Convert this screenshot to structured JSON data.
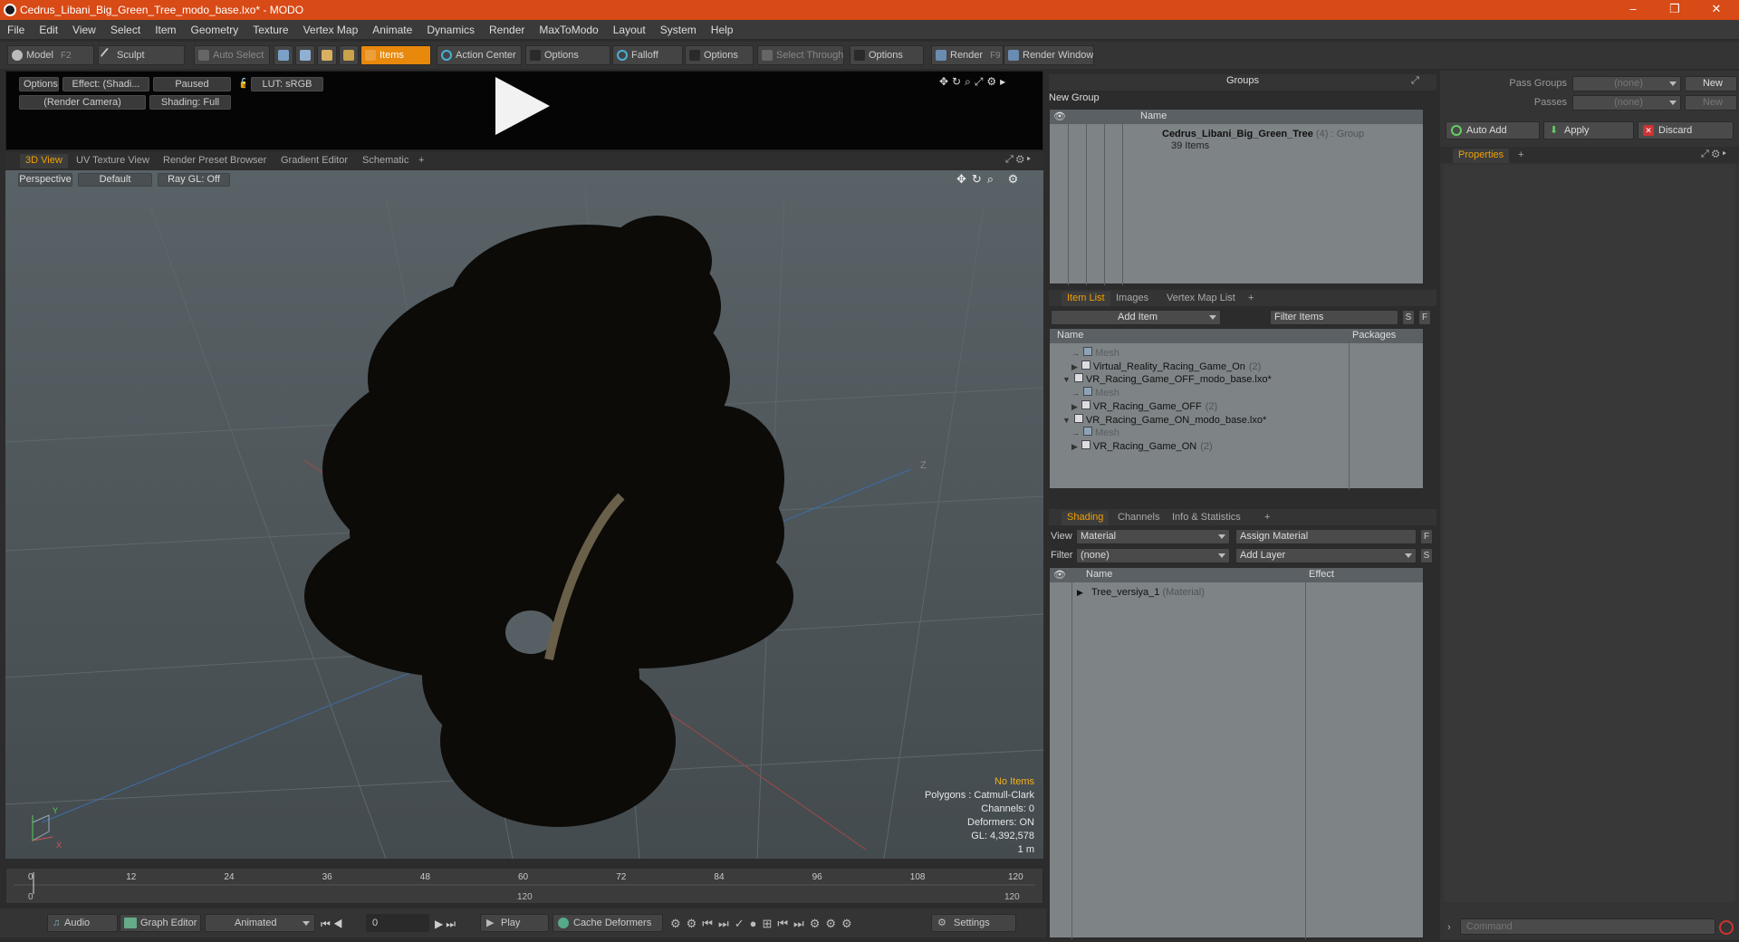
{
  "window": {
    "title": "Cedrus_Libani_Big_Green_Tree_modo_base.lxo* - MODO",
    "minimize": "–",
    "maximize": "❐",
    "close": "✕"
  },
  "menu": [
    "File",
    "Edit",
    "View",
    "Select",
    "Item",
    "Geometry",
    "Texture",
    "Vertex Map",
    "Animate",
    "Dynamics",
    "Render",
    "MaxToModo",
    "Layout",
    "System",
    "Help"
  ],
  "toolbar": {
    "model": "Model",
    "model_key": "F2",
    "sculpt": "Sculpt",
    "auto_select": "Auto Select",
    "items": "Items",
    "action_center": "Action Center",
    "options1": "Options",
    "falloff": "Falloff",
    "options2": "Options",
    "select_through": "Select Through",
    "options3": "Options",
    "render": "Render",
    "render_key": "F9",
    "render_window": "Render Window"
  },
  "preview": {
    "options": "Options",
    "effect": "Effect: (Shadi...",
    "paused": "Paused",
    "lut": "LUT: sRGB",
    "camera": "(Render Camera)",
    "shading": "Shading: Full"
  },
  "view_tabs": [
    "3D View",
    "UV Texture View",
    "Render Preset Browser",
    "Gradient Editor",
    "Schematic",
    "+"
  ],
  "viewport": {
    "perspective": "Perspective",
    "default": "Default",
    "raygl": "Ray GL: Off",
    "no_items": "No Items",
    "polygons": "Polygons : Catmull-Clark",
    "channels": "Channels: 0",
    "deformers": "Deformers: ON",
    "gl": "GL: 4,392,578",
    "scale": "1 m",
    "axis_x": "X",
    "axis_y": "Y",
    "axis_z": "Z"
  },
  "timeline": {
    "ticks": [
      "0",
      "12",
      "24",
      "36",
      "48",
      "60",
      "72",
      "84",
      "96",
      "108",
      "120"
    ],
    "start": "0",
    "mid": "120",
    "end": "120"
  },
  "bottom": {
    "audio": "Audio",
    "graph_editor": "Graph Editor",
    "animated": "Animated",
    "frame": "0",
    "play": "Play",
    "cache_deformers": "Cache Deformers",
    "settings": "Settings"
  },
  "groups": {
    "title": "Groups",
    "new_group": "New Group",
    "name_col": "Name",
    "item_name": "Cedrus_Libani_Big_Green_Tree",
    "item_count": "(4)",
    "item_type": ": Group",
    "item_sub": "39 Items"
  },
  "itemlist": {
    "tabs": [
      "Item List",
      "Images",
      "Vertex Map List",
      "+"
    ],
    "add_item": "Add Item",
    "filter_items": "Filter Items",
    "s": "S",
    "f": "F",
    "name_col": "Name",
    "packages_col": "Packages",
    "rows": [
      {
        "label": "Mesh",
        "count": "",
        "style": "dim",
        "indent": 24
      },
      {
        "label": "Virtual_Reality_Racing_Game_On",
        "count": "(2)",
        "style": "normal",
        "indent": 24
      },
      {
        "label": "VR_Racing_Game_OFF_modo_base.lxo*",
        "count": "",
        "style": "normal",
        "indent": 14
      },
      {
        "label": "Mesh",
        "count": "",
        "style": "dim",
        "indent": 24
      },
      {
        "label": "VR_Racing_Game_OFF",
        "count": "(2)",
        "style": "normal",
        "indent": 24
      },
      {
        "label": "VR_Racing_Game_ON_modo_base.lxo*",
        "count": "",
        "style": "normal",
        "indent": 14
      },
      {
        "label": "Mesh",
        "count": "",
        "style": "dim",
        "indent": 24
      },
      {
        "label": "VR_Racing_Game_ON",
        "count": "(2)",
        "style": "normal",
        "indent": 24
      }
    ]
  },
  "shading": {
    "tabs": [
      "Shading",
      "Channels",
      "Info & Statistics",
      "+"
    ],
    "view_label": "View",
    "view_value": "Material",
    "assign_material": "Assign Material",
    "f": "F",
    "filter_label": "Filter",
    "filter_value": "(none)",
    "add_layer": "Add Layer",
    "s": "S",
    "name_col": "Name",
    "effect_col": "Effect",
    "item_name": "Tree_versiya_1",
    "item_type": "(Material)"
  },
  "right": {
    "pass_groups": "Pass Groups",
    "pass_groups_value": "(none)",
    "new1": "New",
    "passes": "Passes",
    "passes_value": "(none)",
    "new2": "New",
    "auto_add": "Auto Add",
    "apply": "Apply",
    "discard": "Discard",
    "properties_tab": "Properties",
    "plus": "+",
    "command_placeholder": "Command"
  },
  "colors": {
    "accent": "#e8890c",
    "titlebar": "#d84a16",
    "tab_active": "#f0a000"
  }
}
